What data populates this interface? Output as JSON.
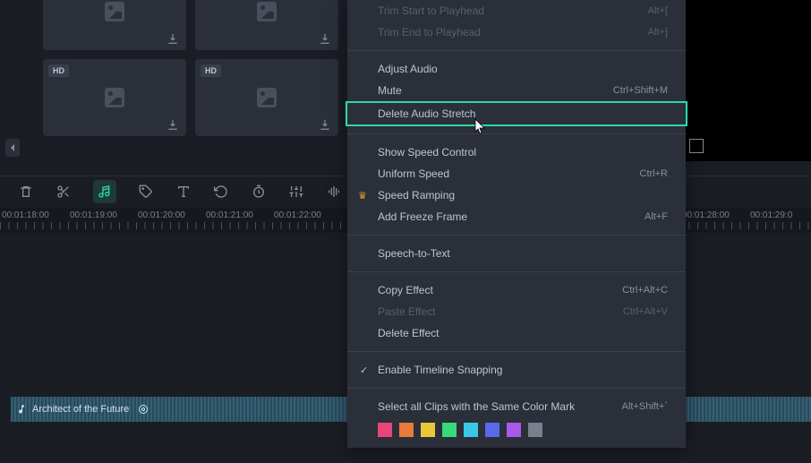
{
  "thumbnails": [
    {
      "hd": false
    },
    {
      "hd": false
    },
    {
      "hd": true
    },
    {
      "hd": true
    }
  ],
  "toolbar_icons": [
    "trash",
    "scissors",
    "audio-stretch",
    "tag",
    "text",
    "rotate-ccw",
    "timer",
    "sliders",
    "equalizer"
  ],
  "ruler_times": [
    "00:01:18:00",
    "00:01:19:00",
    "00:01:20:00",
    "00:01:21:00",
    "00:01:22:00",
    "",
    "",
    "",
    "",
    "",
    "00:01:28:00",
    "00:01:29:0"
  ],
  "audio_clip": {
    "title": "Architect of the Future"
  },
  "context_menu": {
    "sections": [
      [
        {
          "label": "Trim Start to Playhead",
          "shortcut": "Alt+[",
          "disabled": true
        },
        {
          "label": "Trim End to Playhead",
          "shortcut": "Alt+]",
          "disabled": true
        }
      ],
      [
        {
          "label": "Adjust Audio"
        },
        {
          "label": "Mute",
          "shortcut": "Ctrl+Shift+M"
        },
        {
          "label": "Delete Audio Stretch",
          "highlight": true
        }
      ],
      [
        {
          "label": "Show Speed Control"
        },
        {
          "label": "Uniform Speed",
          "shortcut": "Ctrl+R"
        },
        {
          "label": "Speed Ramping",
          "crown": true
        },
        {
          "label": "Add Freeze Frame",
          "shortcut": "Alt+F"
        }
      ],
      [
        {
          "label": "Speech-to-Text"
        }
      ],
      [
        {
          "label": "Copy Effect",
          "shortcut": "Ctrl+Alt+C"
        },
        {
          "label": "Paste Effect",
          "shortcut": "Ctrl+Alt+V",
          "disabled": true
        },
        {
          "label": "Delete Effect"
        }
      ],
      [
        {
          "label": "Enable Timeline Snapping",
          "checked": true
        }
      ],
      [
        {
          "label": "Select all Clips with the Same Color Mark",
          "shortcut": "Alt+Shift+`"
        }
      ]
    ],
    "color_marks": [
      "#e8457a",
      "#e87a3a",
      "#e8c83a",
      "#3ad97a",
      "#3ac8e8",
      "#5a6ae8",
      "#a85ae8",
      "#7a7f8c"
    ]
  }
}
